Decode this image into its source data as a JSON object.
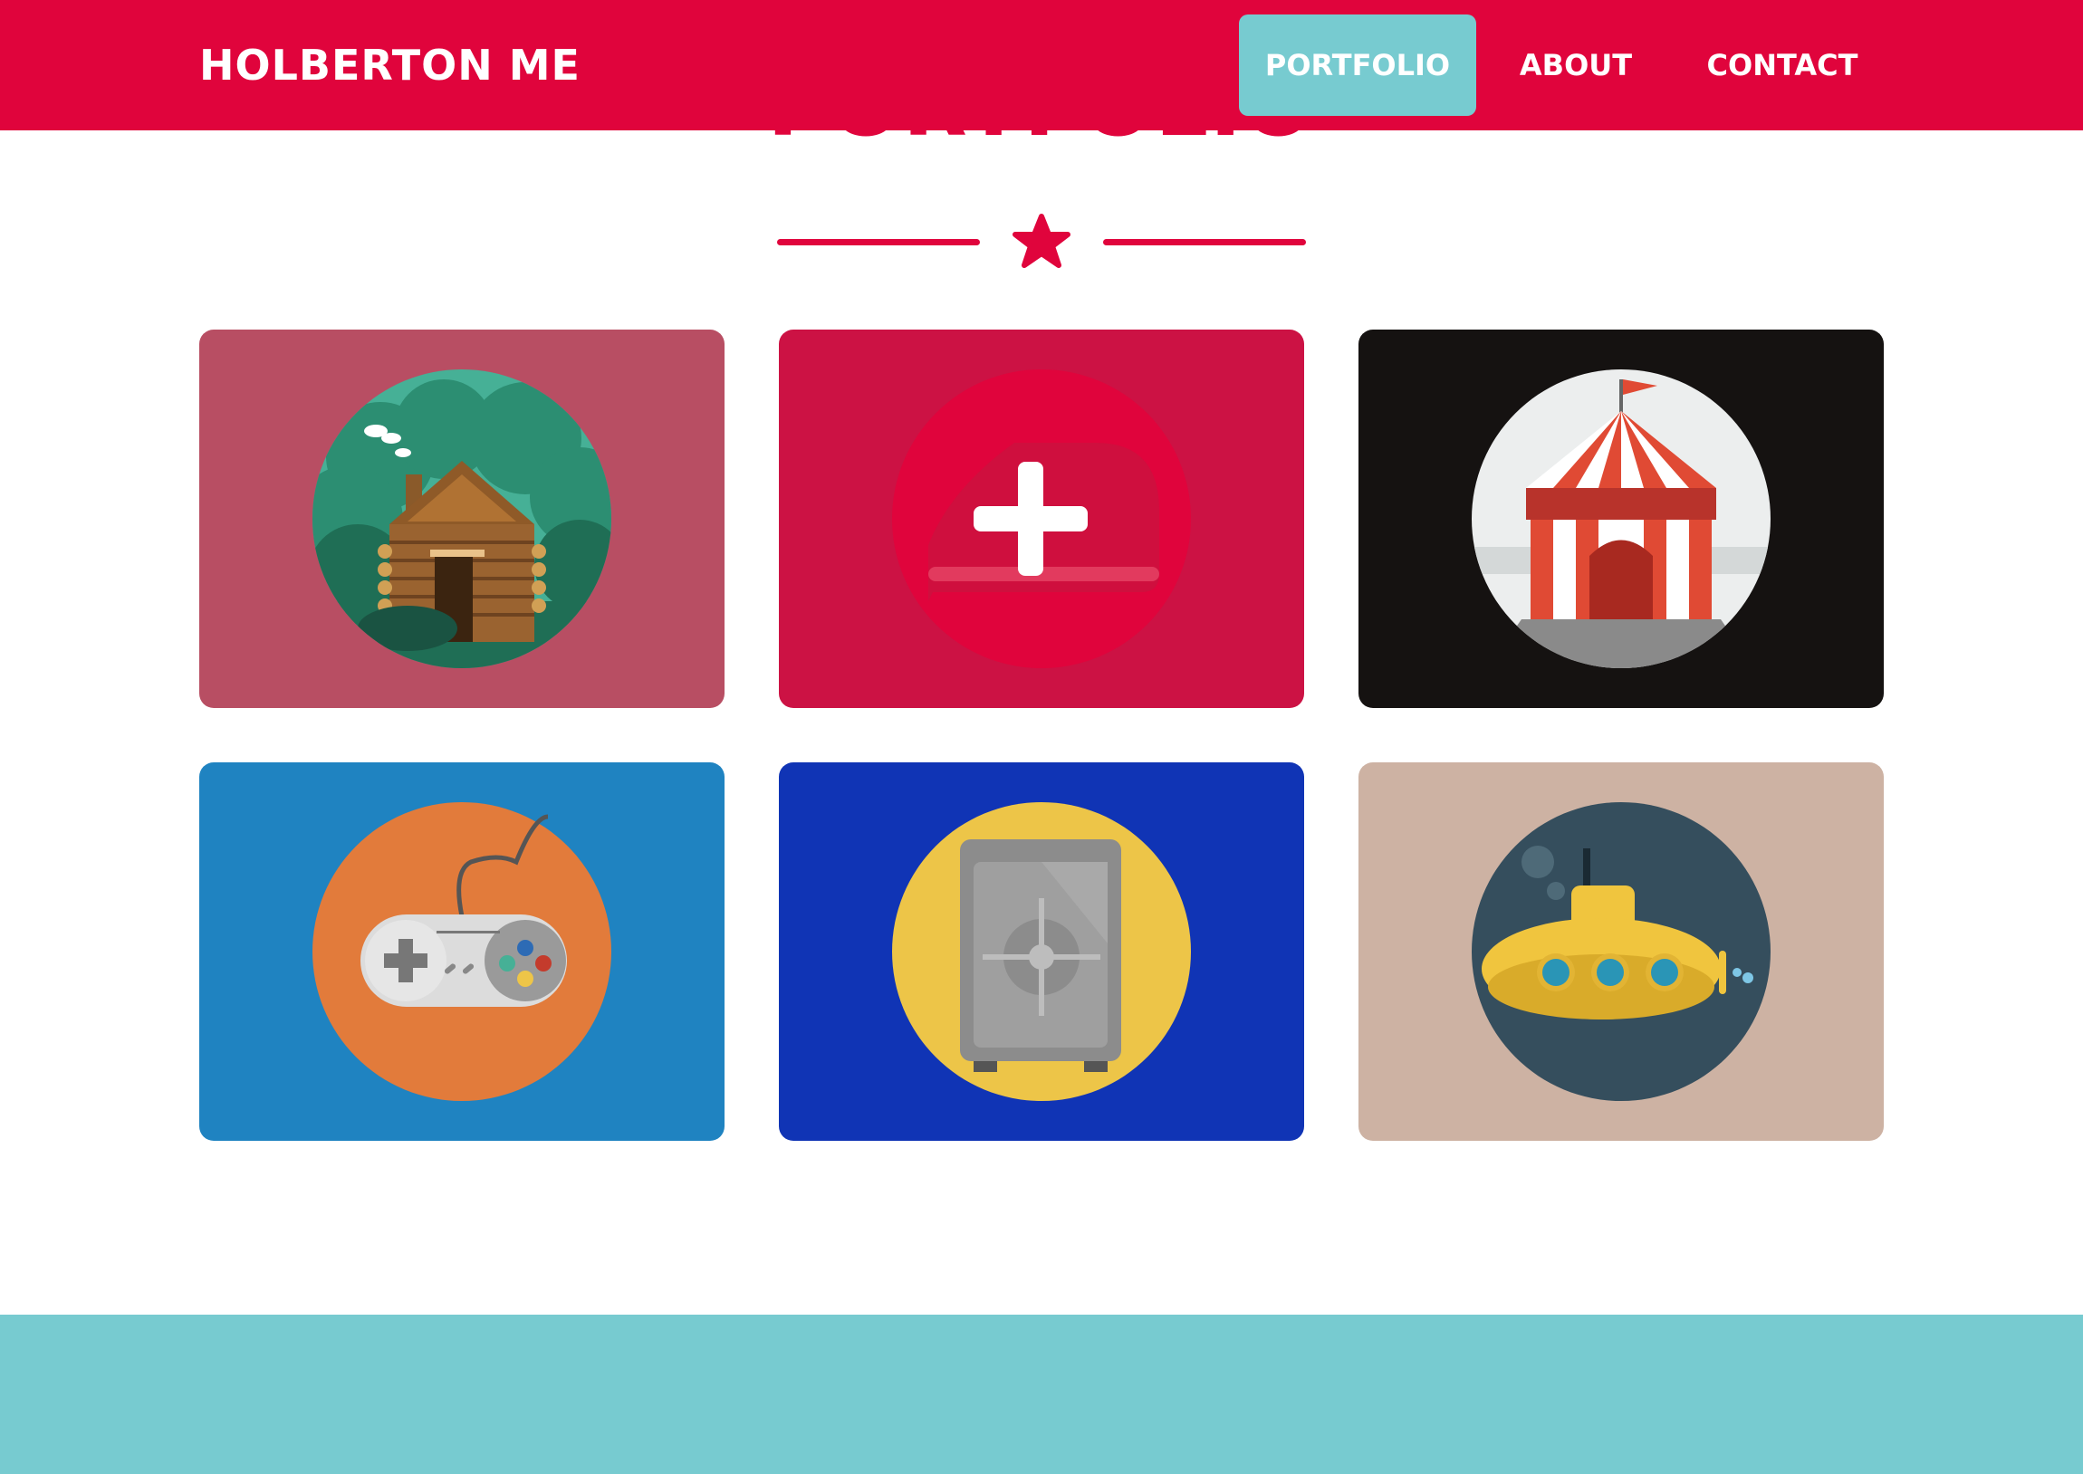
{
  "navbar": {
    "brand": "HOLBERTON ME",
    "links": [
      {
        "label": "PORTFOLIO",
        "active": true
      },
      {
        "label": "ABOUT",
        "active": false
      },
      {
        "label": "CONTACT",
        "active": false
      }
    ]
  },
  "section": {
    "title": "PORTFOLIO",
    "divider_icon": "star-icon"
  },
  "portfolio": {
    "items": [
      {
        "icon": "log-cabin-icon",
        "background": "#b84e63",
        "circle": "#46b096"
      },
      {
        "icon": "health-plus-icon",
        "background": "#cc1244",
        "circle": "#e0043c"
      },
      {
        "icon": "circus-tent-icon",
        "background": "#151211",
        "circle": "#eceeee"
      },
      {
        "icon": "game-controller-icon",
        "background": "#1f83c1",
        "circle": "#e27b3b"
      },
      {
        "icon": "safe-icon",
        "background": "#1034b5",
        "circle": "#edc548"
      },
      {
        "icon": "submarine-icon",
        "background": "#cdb2a3",
        "circle": "#354e5d"
      }
    ]
  },
  "colors": {
    "primary": "#e0043c",
    "accent": "#77cbd0"
  }
}
